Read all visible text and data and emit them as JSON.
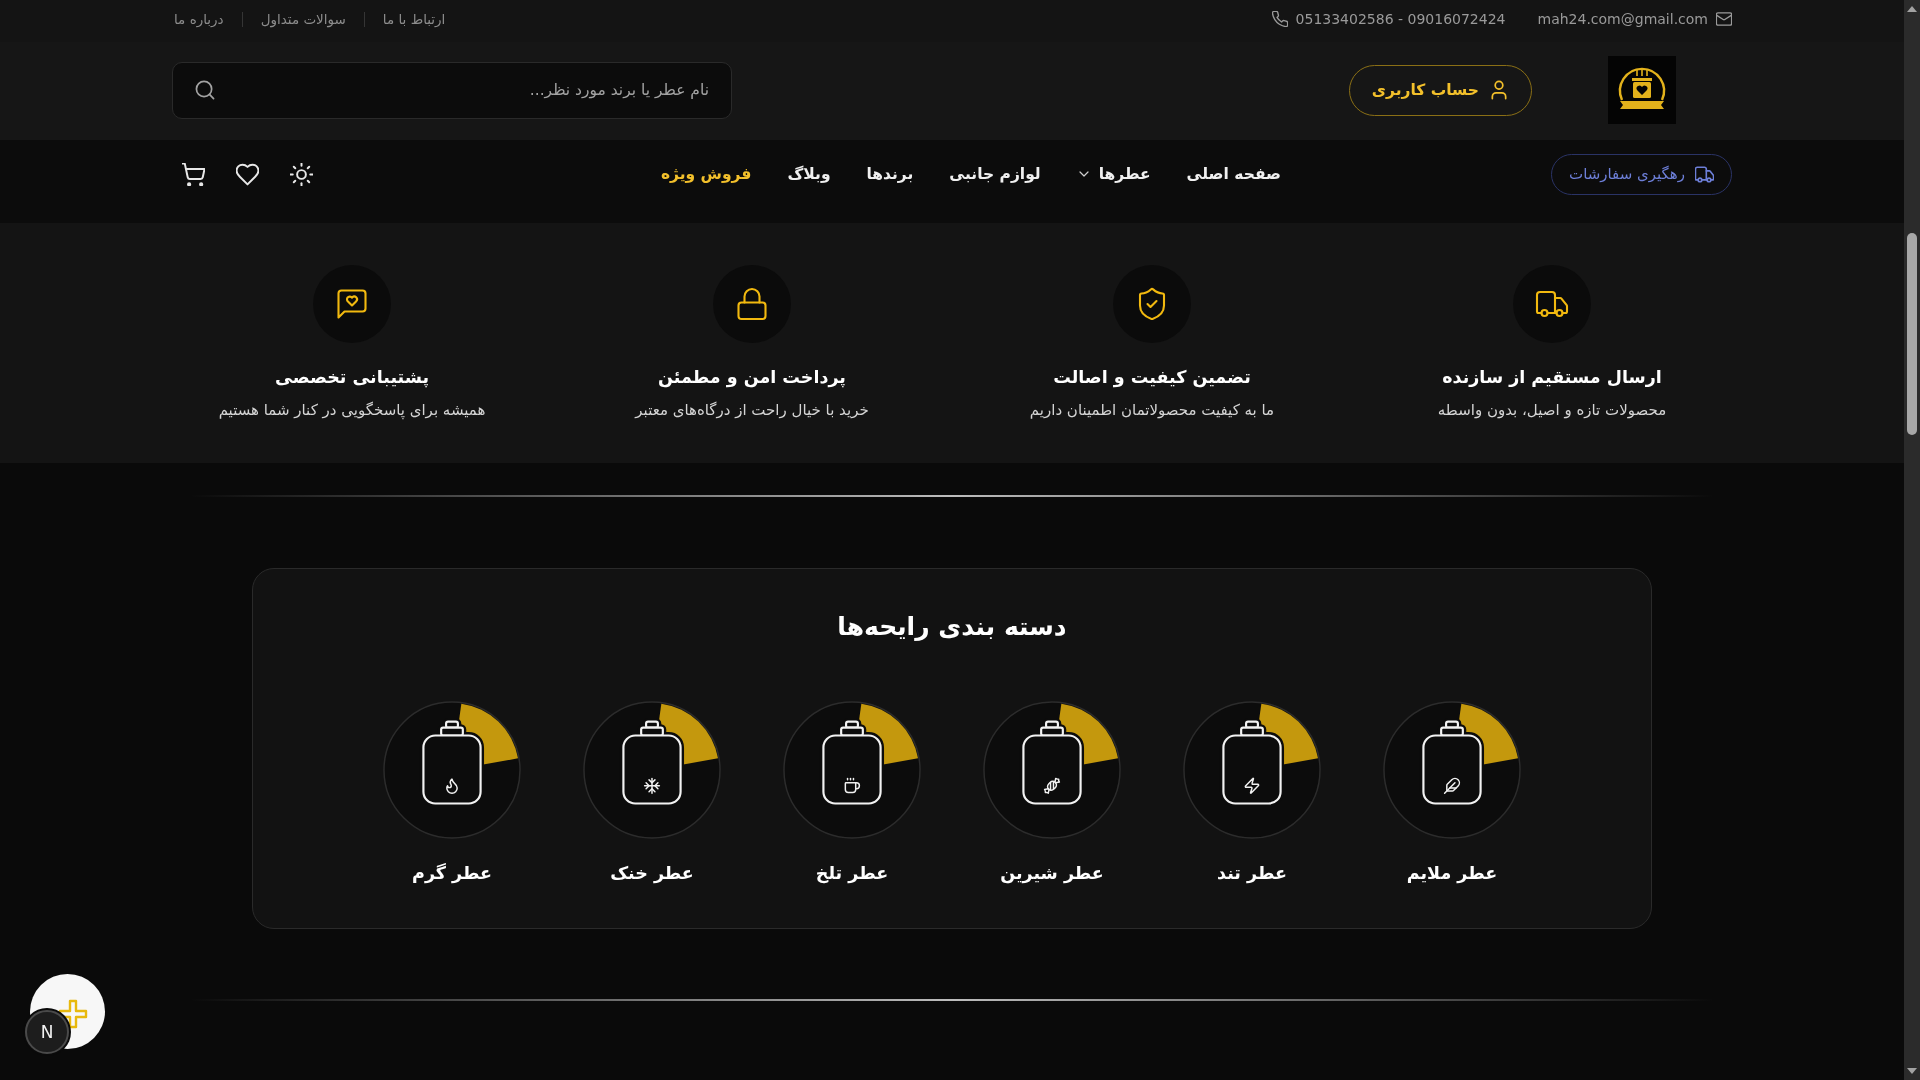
{
  "top_bar": {
    "email": "mah24.com@gmail.com",
    "phone": "05133402586 - 09016072424",
    "links": [
      "ارتباط با ما",
      "سوالات متداول",
      "درباره ما"
    ]
  },
  "header": {
    "account_button": "حساب کاربری",
    "search": {
      "placeholder": "نام عطر یا برند مورد نظر..."
    }
  },
  "nav": {
    "track_orders_button": "رهگیری سفارشات",
    "items": [
      {
        "label": "صفحه اصلی",
        "dropdown": false,
        "highlighted": false
      },
      {
        "label": "عطرها",
        "dropdown": true,
        "highlighted": false
      },
      {
        "label": "لوازم جانبی",
        "dropdown": false,
        "highlighted": false
      },
      {
        "label": "برندها",
        "dropdown": false,
        "highlighted": false
      },
      {
        "label": "وبلاگ",
        "dropdown": false,
        "highlighted": false
      },
      {
        "label": "فروش ویژه",
        "dropdown": false,
        "highlighted": true
      }
    ]
  },
  "features": [
    {
      "title": "ارسال مستقیم از سازنده",
      "description": "محصولات تازه و اصیل، بدون واسطه"
    },
    {
      "title": "تضمین کیفیت و اصالت",
      "description": "ما به کیفیت محصولاتمان اطمینان داریم"
    },
    {
      "title": "پرداخت امن و مطمئن",
      "description": "خرید با خیال راحت از درگاه‌های معتبر"
    },
    {
      "title": "پشتیبانی تخصصی",
      "description": "همیشه برای پاسخگویی در کنار شما هستیم"
    }
  ],
  "categories": {
    "title": "دسته بندی رایحه‌ها",
    "items": [
      "عطر ملایم",
      "عطر تند",
      "عطر شیرین",
      "عطر تلخ",
      "عطر خنک",
      "عطر گرم"
    ]
  },
  "dev_badge": "N"
}
